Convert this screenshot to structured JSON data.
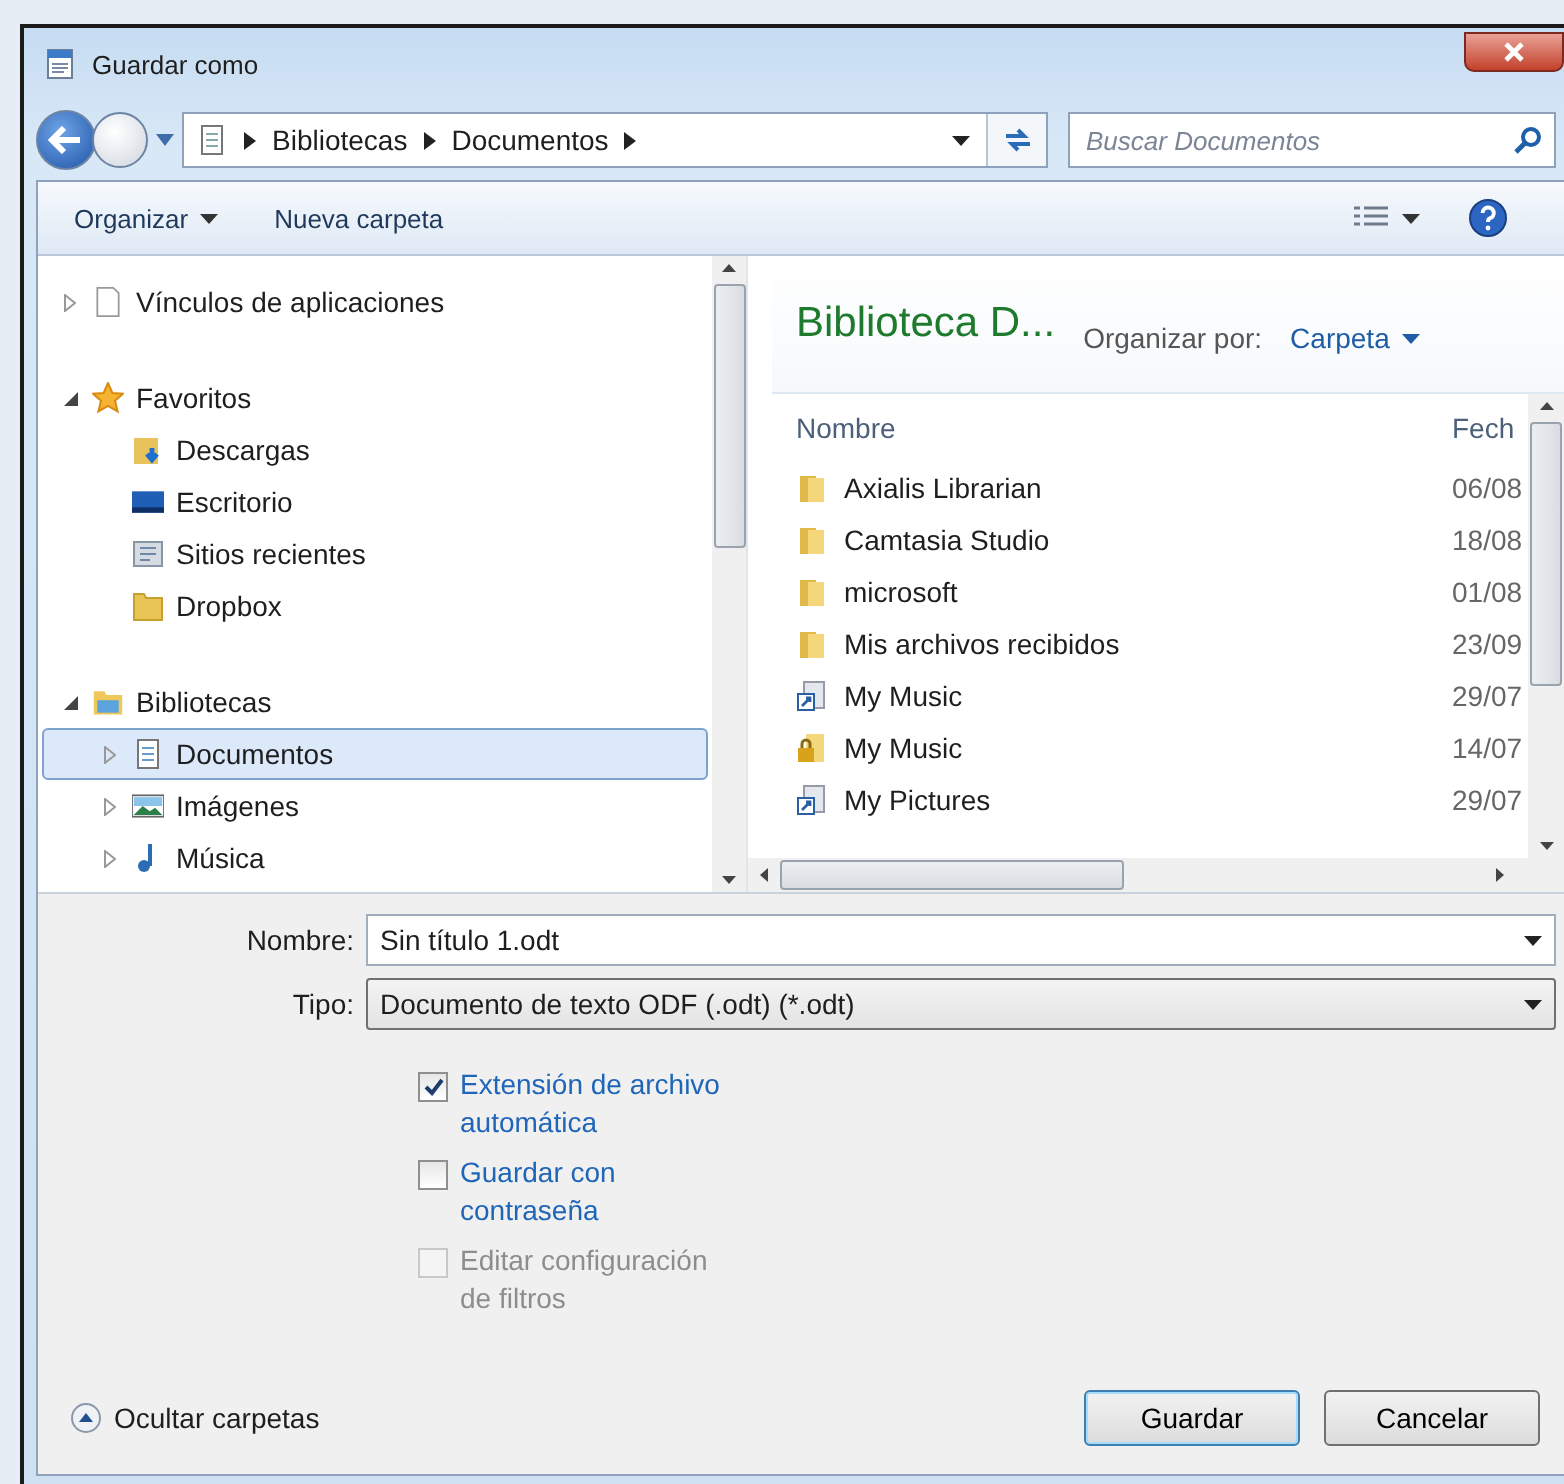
{
  "window": {
    "title": "Guardar como"
  },
  "address": {
    "path": [
      "Bibliotecas",
      "Documentos"
    ],
    "search_placeholder": "Buscar Documentos"
  },
  "toolbar": {
    "organize": "Organizar",
    "new_folder": "Nueva carpeta"
  },
  "nav": [
    {
      "label": "Vínculos de aplicaciones",
      "kind": "page",
      "expanded": false,
      "selected": false
    },
    {
      "label": "Favoritos",
      "kind": "star",
      "expanded": true,
      "selected": false,
      "children": [
        {
          "label": "Descargas",
          "kind": "download",
          "selected": false
        },
        {
          "label": "Escritorio",
          "kind": "desktop",
          "selected": false
        },
        {
          "label": "Sitios recientes",
          "kind": "recent",
          "selected": false
        },
        {
          "label": "Dropbox",
          "kind": "folder",
          "selected": false
        }
      ]
    },
    {
      "label": "Bibliotecas",
      "kind": "library",
      "expanded": true,
      "selected": false,
      "children": [
        {
          "label": "Documentos",
          "kind": "document",
          "expanded": false,
          "selected": true
        },
        {
          "label": "Imágenes",
          "kind": "pictures",
          "expanded": false,
          "selected": false
        },
        {
          "label": "Música",
          "kind": "music",
          "expanded": false,
          "selected": false
        }
      ]
    }
  ],
  "library": {
    "title": "Biblioteca D...",
    "arrange_label": "Organizar por:",
    "arrange_value": "Carpeta"
  },
  "files": {
    "columns": [
      "Nombre",
      "Fech"
    ],
    "rows": [
      {
        "name": "Axialis Librarian",
        "date": "06/08",
        "kind": "folder"
      },
      {
        "name": "Camtasia Studio",
        "date": "18/08",
        "kind": "folder"
      },
      {
        "name": "microsoft",
        "date": "01/08",
        "kind": "folder"
      },
      {
        "name": "Mis archivos recibidos",
        "date": "23/09",
        "kind": "folder"
      },
      {
        "name": "My Music",
        "date": "29/07",
        "kind": "shortcut"
      },
      {
        "name": "My Music",
        "date": "14/07",
        "kind": "locked"
      },
      {
        "name": "My Pictures",
        "date": "29/07",
        "kind": "shortcut"
      }
    ]
  },
  "form": {
    "name_label": "Nombre:",
    "name_value": "Sin título 1.odt",
    "type_label": "Tipo:",
    "type_value": "Documento de texto ODF (.odt) (*.odt)"
  },
  "options": [
    {
      "label": "Extensión de archivo automática",
      "checked": true,
      "disabled": false
    },
    {
      "label": "Guardar con contraseña",
      "checked": false,
      "disabled": false
    },
    {
      "label": "Editar configuración de filtros",
      "checked": false,
      "disabled": true
    }
  ],
  "hide_folders": "Ocultar carpetas",
  "buttons": [
    {
      "label": "Guardar",
      "default": true
    },
    {
      "label": "Cancelar",
      "default": false
    }
  ]
}
